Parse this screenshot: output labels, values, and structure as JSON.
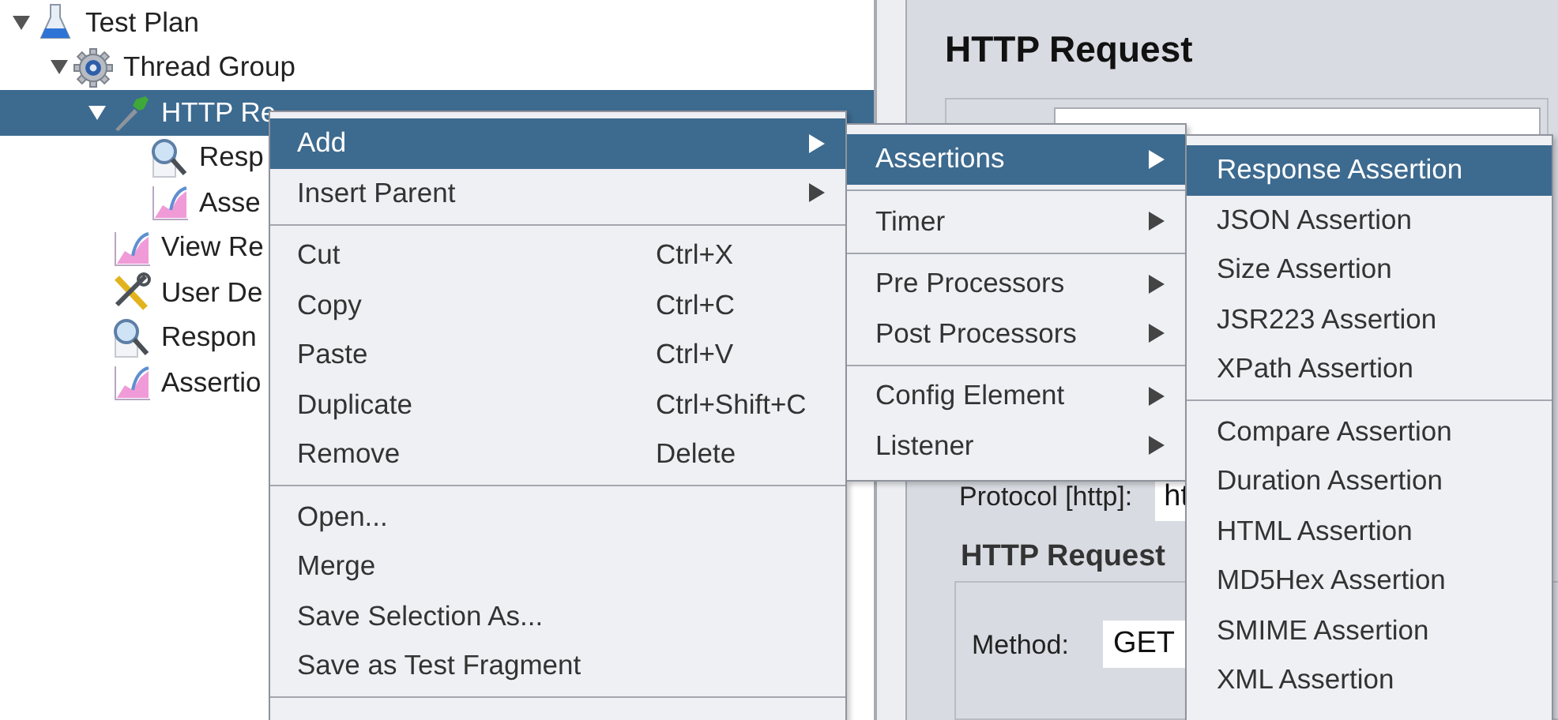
{
  "tree": [
    {
      "label": "Test Plan",
      "kind": "flask",
      "expanded": true,
      "selected": false,
      "children": [
        {
          "label": "Thread Group",
          "kind": "gear",
          "expanded": true,
          "selected": false,
          "children": [
            {
              "label": "HTTP Re",
              "kind": "dropper",
              "expanded": true,
              "selected": true,
              "children": [
                {
                  "label": "Resp",
                  "kind": "magnifier",
                  "selected": false
                },
                {
                  "label": "Asse",
                  "kind": "graph",
                  "selected": false
                }
              ]
            },
            {
              "label": "View Re",
              "kind": "graph",
              "selected": false
            },
            {
              "label": "User De",
              "kind": "tools",
              "selected": false
            },
            {
              "label": "Respon",
              "kind": "magnifier",
              "selected": false
            },
            {
              "label": "Assertio",
              "kind": "graph",
              "selected": false
            }
          ]
        }
      ]
    }
  ],
  "editor": {
    "title": "HTTP Request",
    "protocol_label": "Protocol [http]:",
    "protocol_value": "ht",
    "section_title": "HTTP Request",
    "method_label": "Method:",
    "method_value": "GET"
  },
  "context_menu": [
    {
      "kind": "item",
      "label": "Add",
      "submenu": true,
      "selected": true
    },
    {
      "kind": "item",
      "label": "Insert Parent",
      "submenu": true,
      "selected": false
    },
    {
      "kind": "separator"
    },
    {
      "kind": "item",
      "label": "Cut",
      "shortcut": "Ctrl+X",
      "submenu": false,
      "selected": false
    },
    {
      "kind": "item",
      "label": "Copy",
      "shortcut": "Ctrl+C",
      "submenu": false,
      "selected": false
    },
    {
      "kind": "item",
      "label": "Paste",
      "shortcut": "Ctrl+V",
      "submenu": false,
      "selected": false
    },
    {
      "kind": "item",
      "label": "Duplicate",
      "shortcut": "Ctrl+Shift+C",
      "submenu": false,
      "selected": false
    },
    {
      "kind": "item",
      "label": "Remove",
      "shortcut": "Delete",
      "submenu": false,
      "selected": false
    },
    {
      "kind": "separator"
    },
    {
      "kind": "item",
      "label": "Open...",
      "submenu": false,
      "selected": false
    },
    {
      "kind": "item",
      "label": "Merge",
      "submenu": false,
      "selected": false
    },
    {
      "kind": "item",
      "label": "Save Selection As...",
      "submenu": false,
      "selected": false
    },
    {
      "kind": "item",
      "label": "Save as Test Fragment",
      "submenu": false,
      "selected": false
    },
    {
      "kind": "separator"
    }
  ],
  "add_menu": [
    {
      "kind": "item",
      "label": "Assertions",
      "submenu": true,
      "selected": true
    },
    {
      "kind": "separator"
    },
    {
      "kind": "item",
      "label": "Timer",
      "submenu": true,
      "selected": false
    },
    {
      "kind": "separator"
    },
    {
      "kind": "item",
      "label": "Pre Processors",
      "submenu": true,
      "selected": false
    },
    {
      "kind": "item",
      "label": "Post Processors",
      "submenu": true,
      "selected": false
    },
    {
      "kind": "separator"
    },
    {
      "kind": "item",
      "label": "Config Element",
      "submenu": true,
      "selected": false
    },
    {
      "kind": "item",
      "label": "Listener",
      "submenu": true,
      "selected": false
    }
  ],
  "assertions_menu": [
    {
      "kind": "item",
      "label": "Response Assertion",
      "submenu": false,
      "selected": true
    },
    {
      "kind": "item",
      "label": "JSON Assertion",
      "submenu": false,
      "selected": false
    },
    {
      "kind": "item",
      "label": "Size Assertion",
      "submenu": false,
      "selected": false
    },
    {
      "kind": "item",
      "label": "JSR223 Assertion",
      "submenu": false,
      "selected": false
    },
    {
      "kind": "item",
      "label": "XPath Assertion",
      "submenu": false,
      "selected": false
    },
    {
      "kind": "separator"
    },
    {
      "kind": "item",
      "label": "Compare Assertion",
      "submenu": false,
      "selected": false
    },
    {
      "kind": "item",
      "label": "Duration Assertion",
      "submenu": false,
      "selected": false
    },
    {
      "kind": "item",
      "label": "HTML Assertion",
      "submenu": false,
      "selected": false
    },
    {
      "kind": "item",
      "label": "MD5Hex Assertion",
      "submenu": false,
      "selected": false
    },
    {
      "kind": "item",
      "label": "SMIME Assertion",
      "submenu": false,
      "selected": false
    },
    {
      "kind": "item",
      "label": "XML Assertion",
      "submenu": false,
      "selected": false
    }
  ]
}
